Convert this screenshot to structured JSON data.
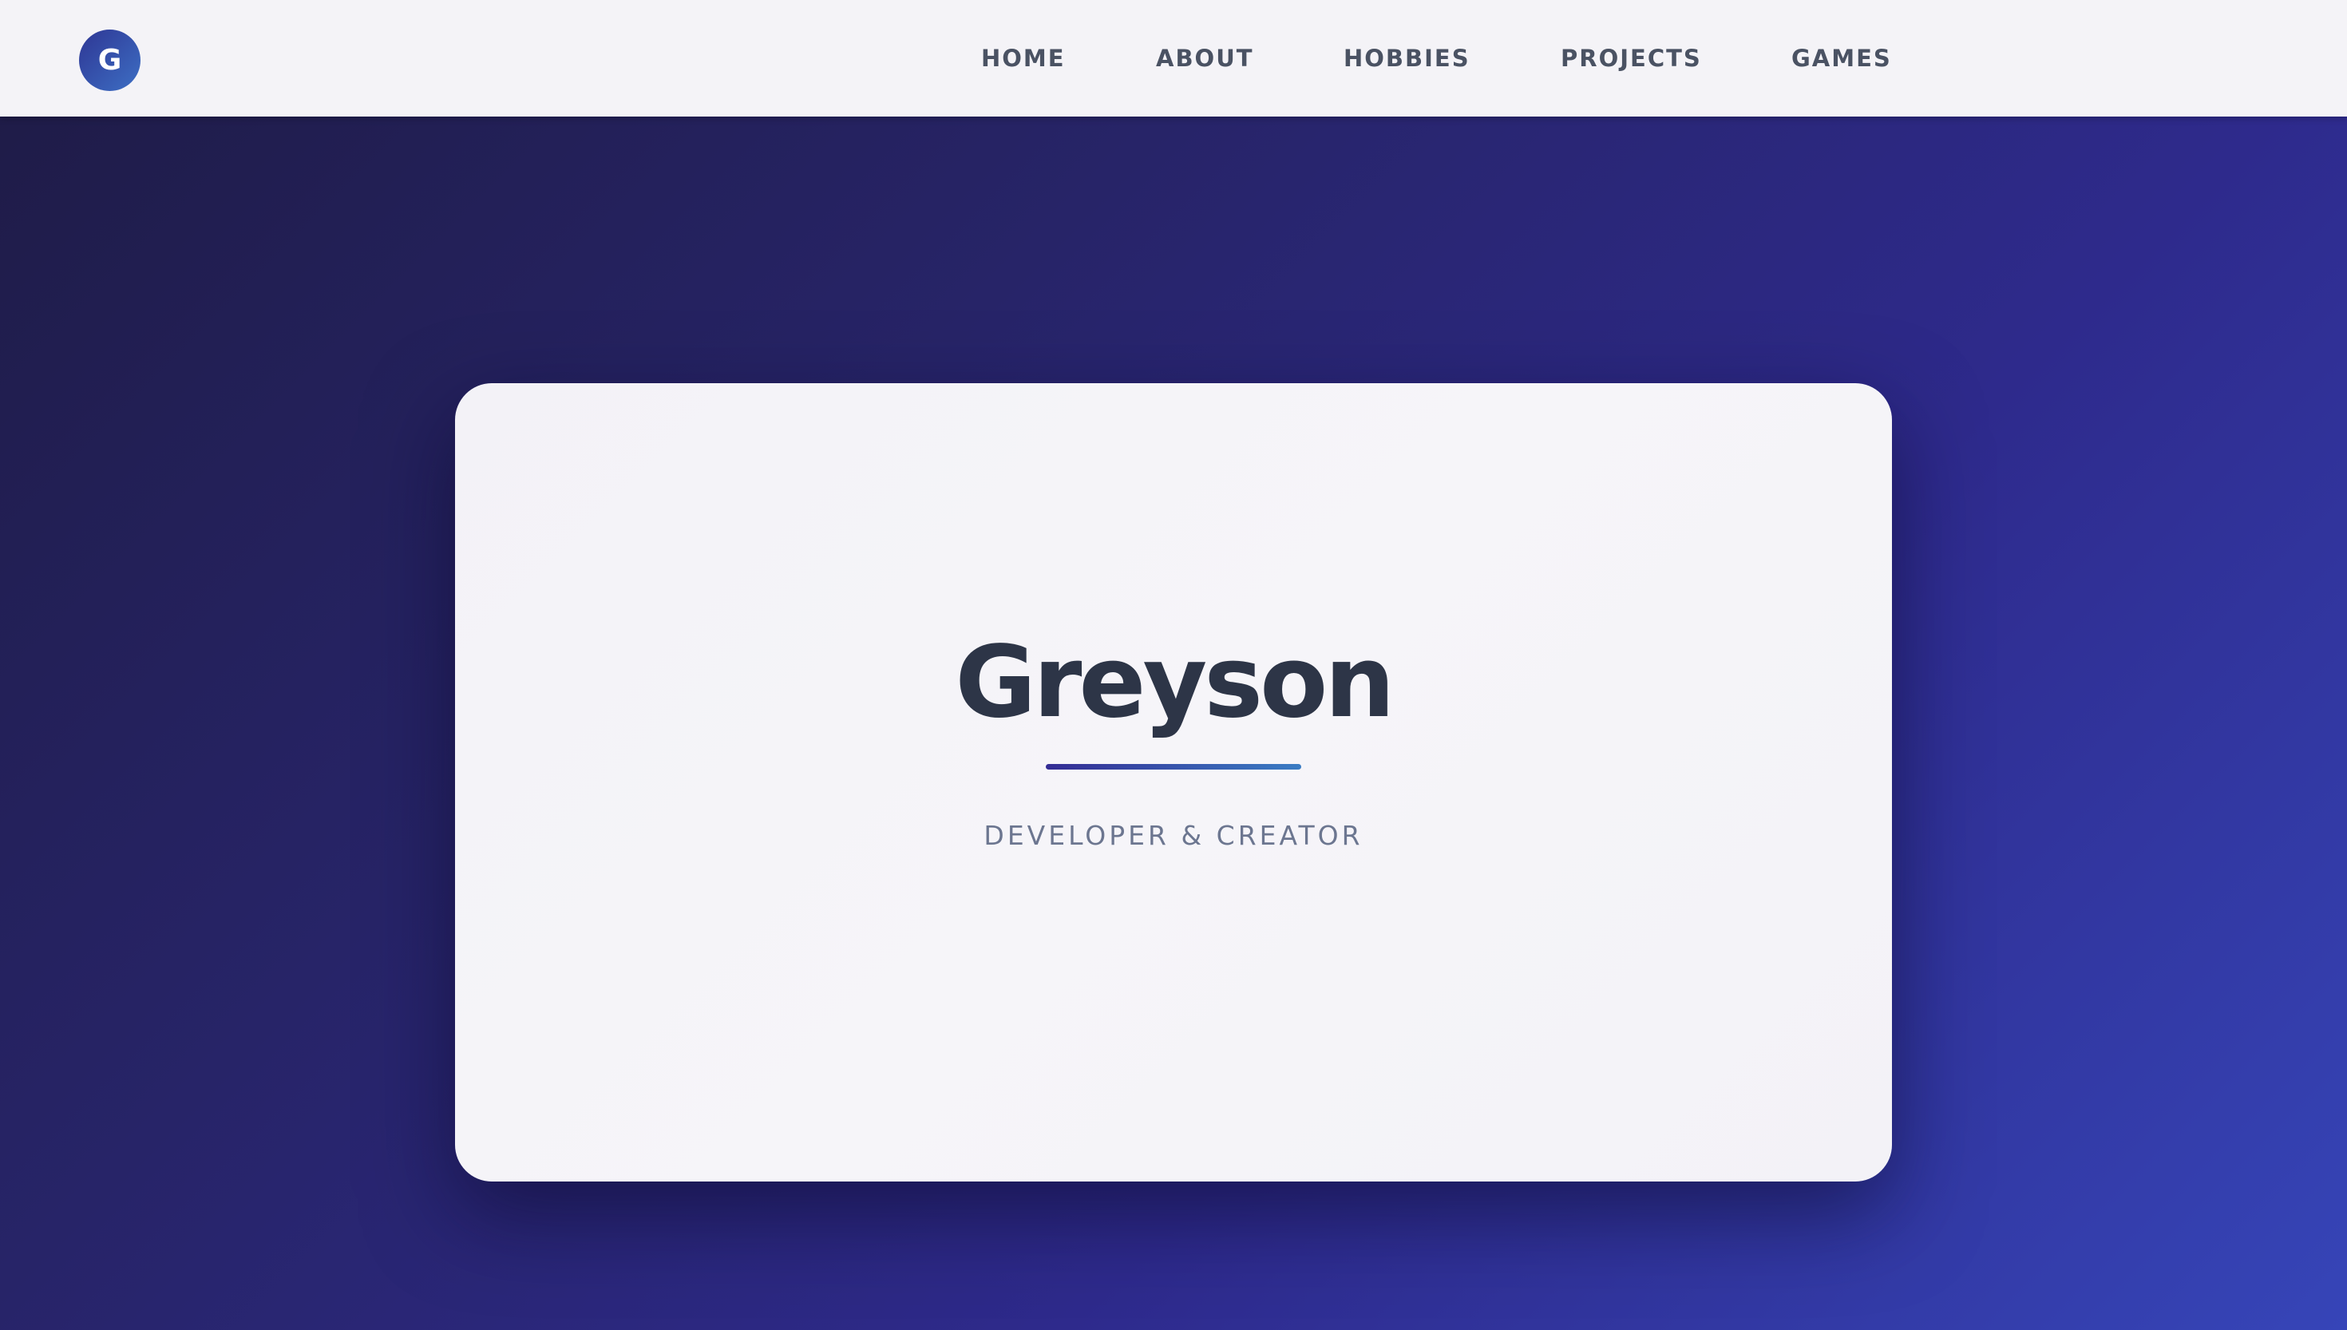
{
  "header": {
    "logo_letter": "G",
    "nav": [
      {
        "label": "HOME"
      },
      {
        "label": "ABOUT"
      },
      {
        "label": "HOBBIES"
      },
      {
        "label": "PROJECTS"
      },
      {
        "label": "GAMES"
      }
    ]
  },
  "hero": {
    "name": "Greyson",
    "tagline": "DEVELOPER & CREATOR"
  },
  "colors": {
    "nav_background": "#f4f3f7",
    "nav_text": "#4a5263",
    "background_gradient_start": "#1e1b45",
    "background_gradient_end": "#3645b8",
    "card_background": "#f4f3f7",
    "title_text": "#2d3547",
    "subtitle_text": "#6c7690",
    "accent_gradient_start": "#342c94",
    "accent_gradient_end": "#3a7cc4"
  }
}
